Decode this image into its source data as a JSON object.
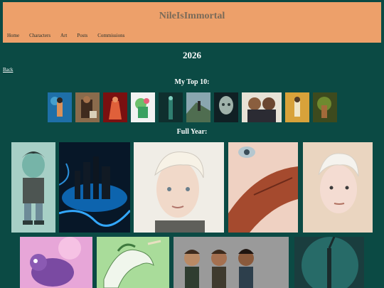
{
  "site": {
    "title": "NileIsImmortal"
  },
  "nav": {
    "items": [
      "Home",
      "Characters",
      "Art",
      "Posts",
      "Commissions"
    ]
  },
  "page": {
    "title": "2026",
    "back_label": "Back"
  },
  "top10": {
    "heading": "My Top 10:"
  },
  "full_year": {
    "heading": "Full Year:"
  },
  "colors": {
    "background": "#0b4a44",
    "header": "#eda06a",
    "title_text": "#7a6a58"
  }
}
